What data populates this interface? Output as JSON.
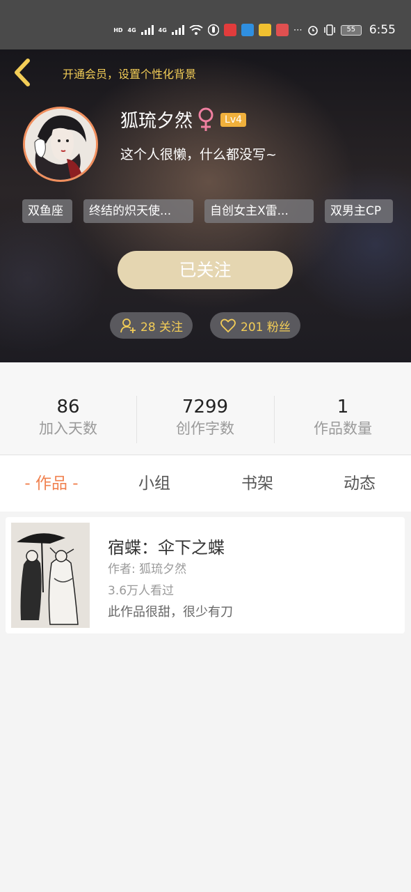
{
  "status_bar": {
    "time": "6:55",
    "battery": "55",
    "network_labels": [
      "HD",
      "4G",
      "4G"
    ]
  },
  "header": {
    "vip_banner": "开通会员，设置个性化背景",
    "username": "狐琉夕然",
    "level": "Lv4",
    "bio": "这个人很懒，什么都没写~",
    "tags": [
      "双鱼座",
      "终结的炽天使...",
      "自创女主X雷...",
      "双男主CP"
    ],
    "follow_button": "已关注",
    "following_pill": "28 关注",
    "fans_pill": "201 粉丝",
    "gender_icon": "female-symbol"
  },
  "stats": [
    {
      "value": "86",
      "label": "加入天数"
    },
    {
      "value": "7299",
      "label": "创作字数"
    },
    {
      "value": "1",
      "label": "作品数量"
    }
  ],
  "tabs": [
    {
      "label": "- 作品 -",
      "active": true
    },
    {
      "label": "小组",
      "active": false
    },
    {
      "label": "书架",
      "active": false
    },
    {
      "label": "动态",
      "active": false
    }
  ],
  "works": [
    {
      "title": "宿蝶：伞下之蝶",
      "author": "作者: 狐琉夕然",
      "views": "3.6万人看过",
      "description": "此作品很甜，很少有刀"
    }
  ],
  "colors": {
    "accent": "#f0814f",
    "gold": "#f3cd57",
    "follow_button": "#e5d6b1",
    "level_badge": "#f0b03c",
    "avatar_border": "#f08f5e"
  }
}
